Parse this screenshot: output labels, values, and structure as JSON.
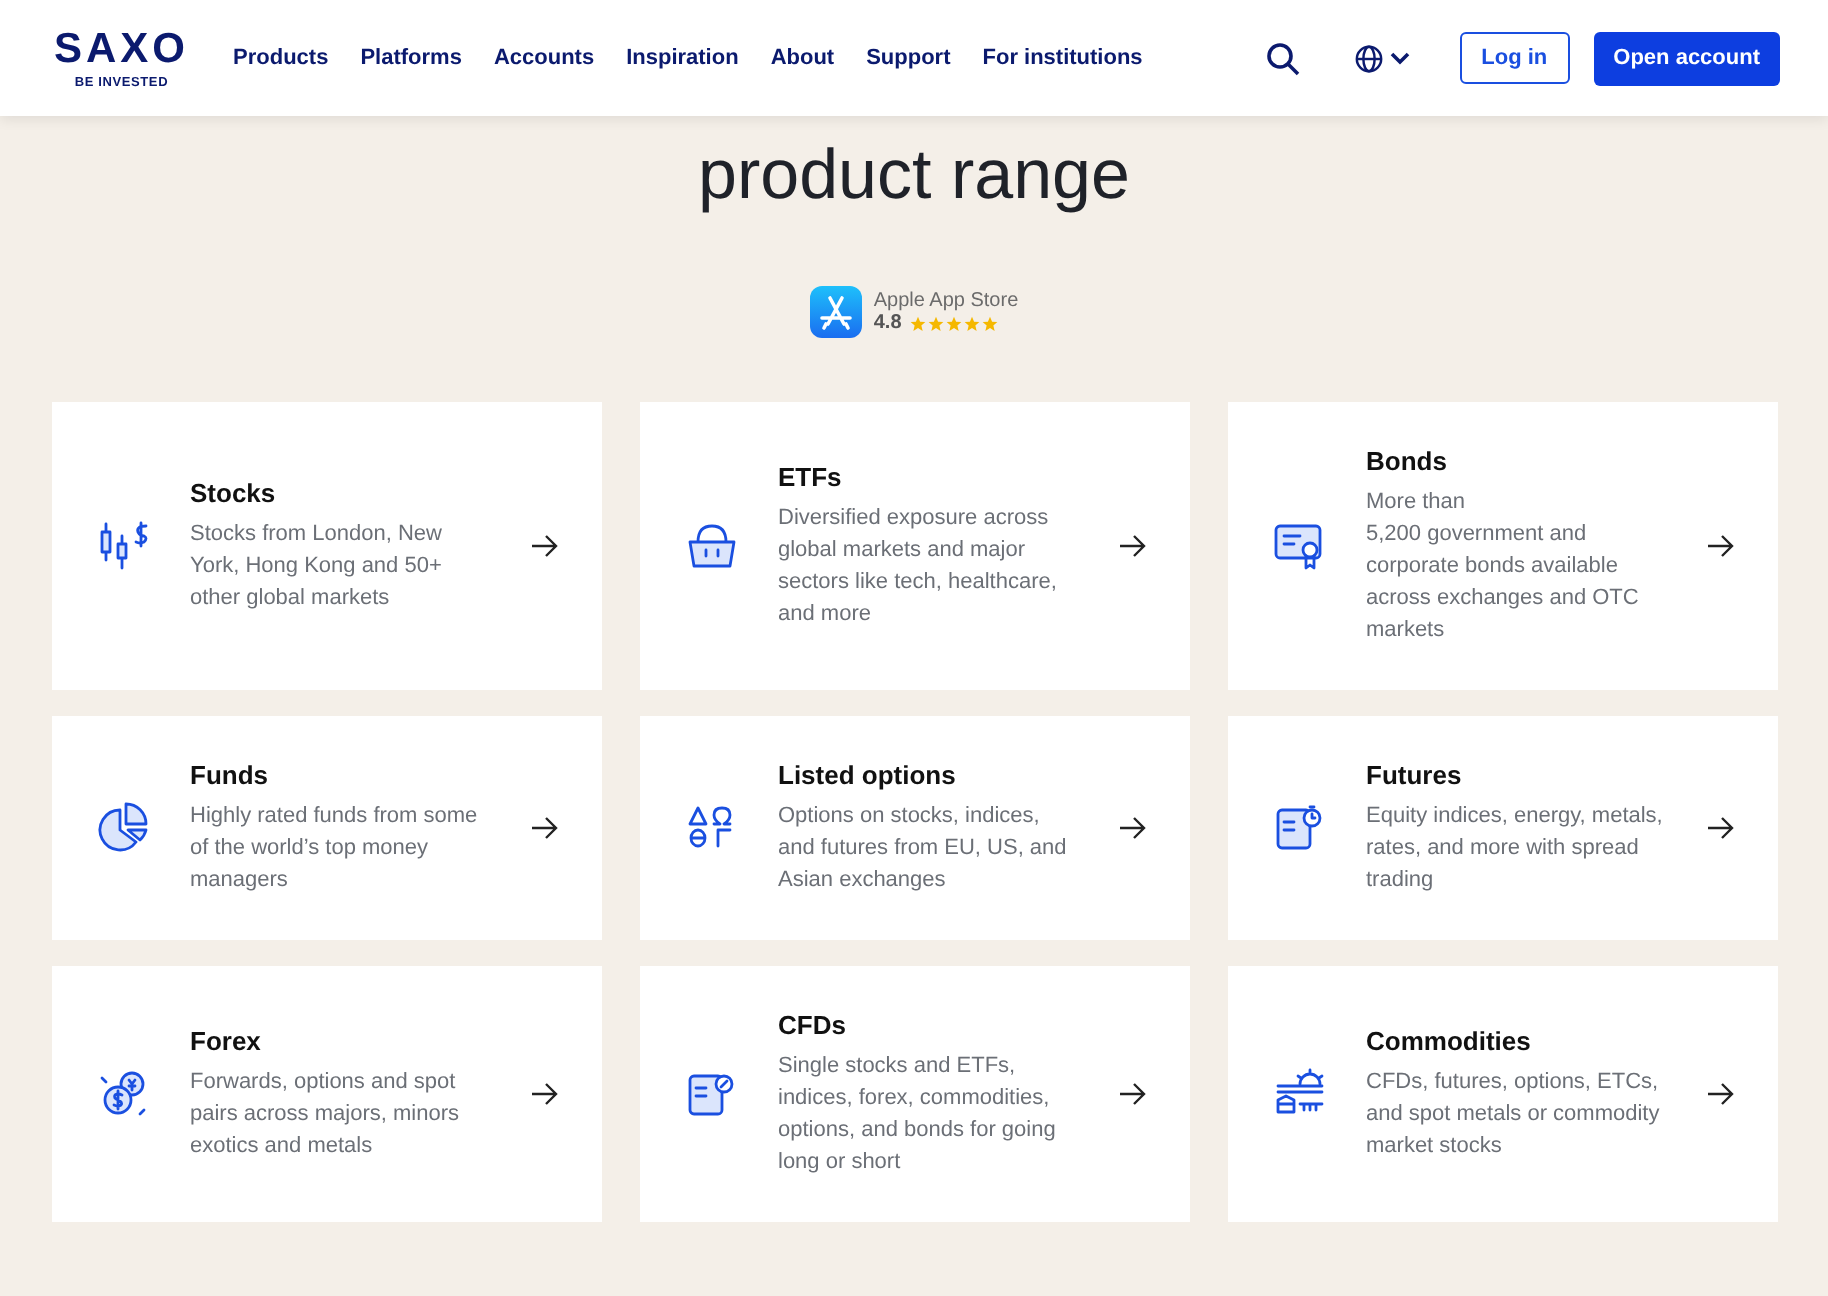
{
  "header": {
    "logo": "SAXO",
    "tagline": "BE INVESTED",
    "nav": [
      "Products",
      "Platforms",
      "Accounts",
      "Inspiration",
      "About",
      "Support",
      "For institutions"
    ],
    "login": "Log in",
    "open_account": "Open account"
  },
  "heading": "product range",
  "rating": {
    "store": "Apple App Store",
    "score": "4.8",
    "stars": 5
  },
  "products": [
    {
      "title": "Stocks",
      "description": "Stocks from London, New York, Hong Kong and 50+ other global markets"
    },
    {
      "title": "ETFs",
      "description": "Diversified exposure across global markets and major sectors like tech, healthcare, and more"
    },
    {
      "title": "Bonds",
      "description": "More than\n5,200 government and corporate bonds available across exchanges and OTC markets"
    },
    {
      "title": "Funds",
      "description": "Highly rated funds from some of the world’s top money managers"
    },
    {
      "title": "Listed options",
      "description": "Options on stocks, indices, and futures from EU, US, and Asian exchanges"
    },
    {
      "title": "Futures",
      "description": "Equity indices, energy, metals, rates, and more with spread trading"
    },
    {
      "title": "Forex",
      "description": "Forwards, options and spot pairs across majors, minors exotics and metals"
    },
    {
      "title": "CFDs",
      "description": "Single stocks and ETFs, indices, forex, commodities, options, and bonds for going long or short"
    },
    {
      "title": "Commodities",
      "description": "CFDs, futures, options, ETCs, and spot metals or commodity market stocks"
    }
  ]
}
